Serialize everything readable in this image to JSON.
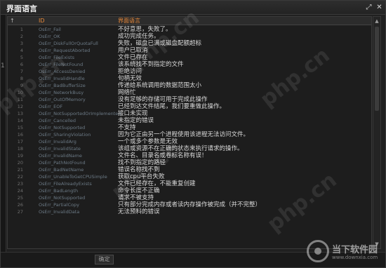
{
  "window": {
    "title": "界面语言",
    "restore_glyph": "⤢",
    "close_glyph": "✕"
  },
  "left_strip_text": "1",
  "table": {
    "headers": {
      "arrow": "↑",
      "id": "ID",
      "message": "界面语言"
    },
    "rows": [
      {
        "num": "1",
        "id": "OsErr_Fail",
        "msg": "不好意思，失败了。"
      },
      {
        "num": "2",
        "id": "OsErr_OK",
        "msg": "成功完成任务。"
      },
      {
        "num": "3",
        "id": "OsErr_DiskFullOrQuotaFull",
        "msg": "失败，磁盘已满或磁盘配额超标"
      },
      {
        "num": "4",
        "id": "OsErr_RequestAborted",
        "msg": "用户已取消"
      },
      {
        "num": "5",
        "id": "OsErr_FileExists",
        "msg": "文件已存在"
      },
      {
        "num": "6",
        "id": "OsErr_FileNotFound",
        "msg": "该系统找不到指定的文件"
      },
      {
        "num": "7",
        "id": "OsErr_AccessDenied",
        "msg": "拒绝访问"
      },
      {
        "num": "8",
        "id": "OsErr_InvalidHandle",
        "msg": "句柄无效"
      },
      {
        "num": "9",
        "id": "OsErr_BadBufferSize",
        "msg": "传递给系统调用的数据范围太小"
      },
      {
        "num": "10",
        "id": "OsErr_NetworkBusy",
        "msg": "网络忙"
      },
      {
        "num": "11",
        "id": "OsErr_OutOfMemory",
        "msg": "没有足够的存储可用于完成此操作"
      },
      {
        "num": "12",
        "id": "OsErr_EOF",
        "msg": "已经到达文件结尾，我们要重做此操作。"
      },
      {
        "num": "13",
        "id": "OsErr_NotSupportedOrImplemented",
        "msg": "接口未实现"
      },
      {
        "num": "14",
        "id": "OsErr_Cancelled",
        "msg": "未指定的错误"
      },
      {
        "num": "15",
        "id": "OsErr_NotSupported",
        "msg": "不支持"
      },
      {
        "num": "16",
        "id": "OsErr_SharingViolation",
        "msg": "因为它正由另一个进程使用该进程无法访问文件。"
      },
      {
        "num": "17",
        "id": "OsErr_InvalidArg",
        "msg": "一个或多个参数是无效"
      },
      {
        "num": "18",
        "id": "OsErr_InvalidState",
        "msg": "该组或资源不在正确的状态来执行请求的操作。"
      },
      {
        "num": "19",
        "id": "OsErr_InvalidName",
        "msg": "文件名、目录名或卷标名称有误！"
      },
      {
        "num": "20",
        "id": "OsErr_PathNotFound",
        "msg": "找不到指定的路径"
      },
      {
        "num": "21",
        "id": "OsErr_BadNetName",
        "msg": "错误名称找不到"
      },
      {
        "num": "22",
        "id": "OsErr_UnableToGetCPUSimple",
        "msg": "获取cpu平台失败"
      },
      {
        "num": "23",
        "id": "OsErr_FileAlreadyExists",
        "msg": "文件已经存在，不能重复创建"
      },
      {
        "num": "24",
        "id": "OsErr_BadLength",
        "msg": "命令长度不正确"
      },
      {
        "num": "25",
        "id": "OsErr_NotSupported",
        "msg": "请求不被支持"
      },
      {
        "num": "26",
        "id": "OsErr_PartialCopy",
        "msg": "只有部分完成内存或者读内存操作被完成（并不完整）"
      },
      {
        "num": "27",
        "id": "OsErr_InvalidData",
        "msg": "无法预料的错误"
      }
    ]
  },
  "ok_button_label": "确定",
  "watermark_text": "php.cn",
  "logo": {
    "text": "当下软件园",
    "subtext": "www.downxia.com"
  }
}
